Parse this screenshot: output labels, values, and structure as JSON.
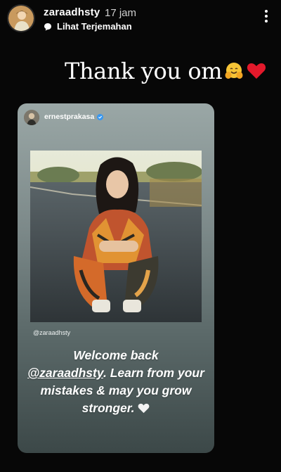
{
  "post": {
    "username": "zaraadhsty",
    "time": "17 jam",
    "translate_label": "Lihat Terjemahan",
    "caption": "Thank you om"
  },
  "shared_story": {
    "username": "ernestprakasa",
    "photo_mention": "@zaraadhsty",
    "message_prefix": "Welcome back",
    "message_mention": "@zaraadhsty",
    "message_rest": ". Learn from your mistakes & may you grow stronger."
  },
  "icons": {
    "more": "more-vert-icon",
    "translate": "chat-bubble-icon",
    "verified": "verified-badge-icon",
    "hug_emoji": "hugging-face-emoji",
    "heart_emoji": "red-heart-emoji",
    "white_heart": "white-heart-emoji"
  },
  "colors": {
    "background": "#070707",
    "verified": "#3897f0",
    "heart": "#e3192b"
  }
}
